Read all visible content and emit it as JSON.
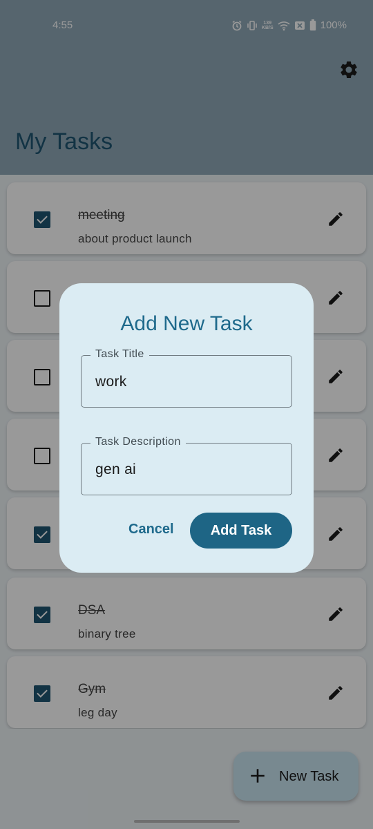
{
  "status_bar": {
    "time": "4:55",
    "speed_value": "139",
    "speed_unit": "KB/S",
    "battery": "100%"
  },
  "app_bar": {
    "title": "My Tasks"
  },
  "tasks": [
    {
      "title": "meeting",
      "description": "about product launch",
      "checked": true
    },
    {
      "title": "",
      "description": "",
      "checked": false
    },
    {
      "title": "",
      "description": "",
      "checked": false
    },
    {
      "title": "",
      "description": "",
      "checked": false
    },
    {
      "title": "",
      "description": "",
      "checked": true
    },
    {
      "title": "DSA",
      "description": "binary tree",
      "checked": true
    },
    {
      "title": "Gym",
      "description": "leg day",
      "checked": true
    }
  ],
  "fab": {
    "label": "New Task"
  },
  "dialog": {
    "title": "Add New Task",
    "title_field": {
      "label": "Task Title",
      "value": "work"
    },
    "description_field": {
      "label": "Task Description",
      "value": "gen ai"
    },
    "cancel_label": "Cancel",
    "confirm_label": "Add Task"
  },
  "colors": {
    "primary": "#1f6a8c",
    "app_bar": "#8fa9b8",
    "dialog_bg": "#dbecf3",
    "fab_bg": "#c9e4f1"
  }
}
